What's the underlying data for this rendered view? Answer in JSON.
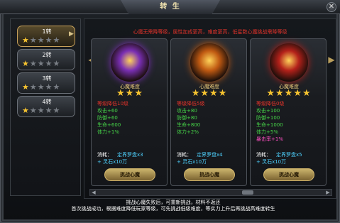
{
  "window": {
    "title": "转 生",
    "close_icon": "close-icon"
  },
  "tiers": [
    {
      "label": "1转",
      "stars": 5,
      "lit": 1,
      "active": true
    },
    {
      "label": "2转",
      "stars": 5,
      "lit": 1,
      "active": false
    },
    {
      "label": "3转",
      "stars": 5,
      "lit": 1,
      "active": false
    },
    {
      "label": "4转",
      "stars": 5,
      "lit": 1,
      "active": false
    }
  ],
  "header_note": "心魔无需降等级，属性加成更高，难度更高，低星数心魔挑战需降等级",
  "cards": [
    {
      "art_color": "#7a2fb3",
      "title": "心魔难度",
      "stars": "★★★",
      "stats": [
        {
          "text": "等级降低10级",
          "tone": "red"
        },
        {
          "text": "攻击+60",
          "tone": "green"
        },
        {
          "text": "防御+60",
          "tone": "green"
        },
        {
          "text": "生命+600",
          "tone": "green"
        },
        {
          "text": "体力+1%",
          "tone": "green"
        }
      ],
      "cost_label": "消耗：",
      "cost_item": "定界罗盘x3",
      "plus_item": "+ 灵石x10万",
      "button": "挑战心魔"
    },
    {
      "art_color": "#c05a12",
      "title": "心魔难度",
      "stars": "★★★★",
      "stats": [
        {
          "text": "等级降低5级",
          "tone": "red"
        },
        {
          "text": "攻击+80",
          "tone": "green"
        },
        {
          "text": "防御+80",
          "tone": "green"
        },
        {
          "text": "生命+800",
          "tone": "green"
        },
        {
          "text": "体力+2%",
          "tone": "green"
        }
      ],
      "cost_label": "消耗：",
      "cost_item": "定界罗盘x4",
      "plus_item": "+ 灵石x10万",
      "button": "挑战心魔"
    },
    {
      "art_color": "#b3211a",
      "title": "心魔难度",
      "stars": "★★★★★",
      "stats": [
        {
          "text": "等级降低0级",
          "tone": "red"
        },
        {
          "text": "攻击+100",
          "tone": "green"
        },
        {
          "text": "防御+100",
          "tone": "green"
        },
        {
          "text": "生命+1000",
          "tone": "green"
        },
        {
          "text": "体力+5%",
          "tone": "green"
        },
        {
          "text": "暴击率+1%",
          "tone": "pink"
        }
      ],
      "cost_label": "消耗：",
      "cost_item": "定界罗盘x5",
      "plus_item": "+ 灵石x10万",
      "button": "挑战心魔"
    }
  ],
  "footer": {
    "line1": "挑战心魔失败后，可重新挑战，材料不返还",
    "line2": "首次挑战成功，根据难度降低玩家等级，可先挑战低级难度，等实力上升后再挑战高难度转生"
  }
}
